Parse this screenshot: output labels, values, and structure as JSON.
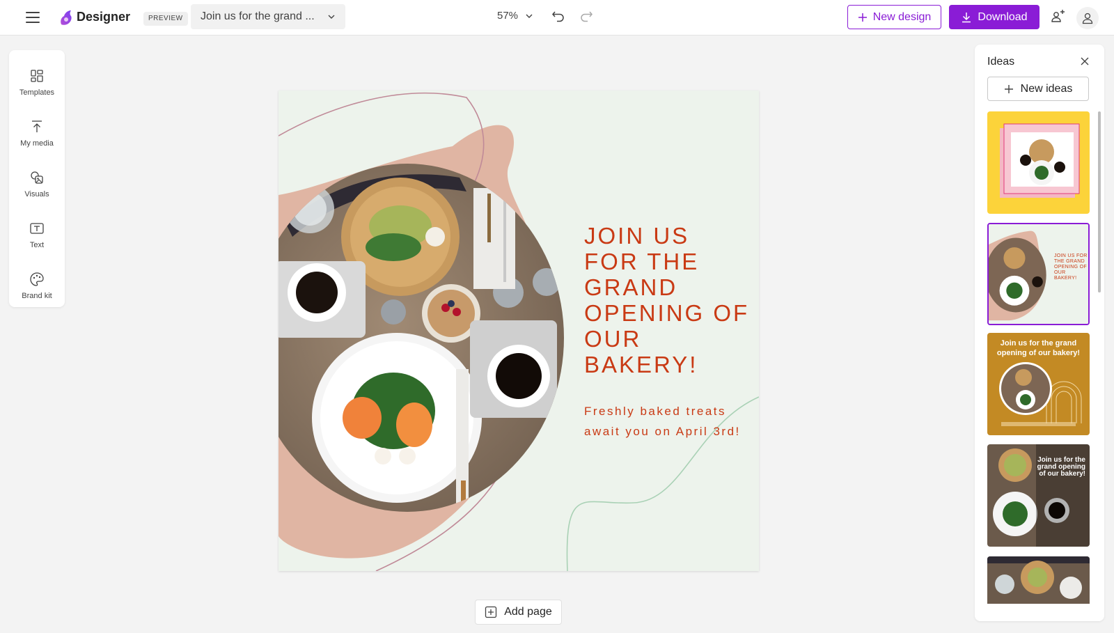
{
  "header": {
    "app_name": "Designer",
    "preview_badge": "PREVIEW",
    "design_title": "Join us for the grand ...",
    "zoom": "57%",
    "new_design_label": "New design",
    "download_label": "Download",
    "icons": [
      "menu-icon",
      "designer-logo-icon",
      "chevron-down-icon",
      "undo-icon",
      "redo-icon",
      "plus-icon",
      "download-icon",
      "share-icon",
      "account-icon"
    ]
  },
  "left_toolbar": {
    "items": [
      {
        "label": "Templates",
        "icon": "templates-icon"
      },
      {
        "label": "My media",
        "icon": "upload-icon"
      },
      {
        "label": "Visuals",
        "icon": "visuals-icon"
      },
      {
        "label": "Text",
        "icon": "text-icon"
      },
      {
        "label": "Brand kit",
        "icon": "palette-icon"
      }
    ]
  },
  "canvas": {
    "headline": "JOIN US FOR THE GRAND OPENING OF OUR BAKERY!",
    "subline": "Freshly baked treats await you on April 3rd!",
    "colors": {
      "background": "#edf3ec",
      "accent_blob": "#e0b5a3",
      "text": "#c93a14",
      "line_green": "#a9d1b5",
      "line_mauve": "#c08a98"
    }
  },
  "add_page_label": "Add page",
  "ideas_panel": {
    "title": "Ideas",
    "new_ideas_label": "New ideas",
    "thumbnails": [
      {
        "style": "yellow-pink-frames",
        "selected": false
      },
      {
        "style": "mint-blob",
        "selected": true,
        "text": "JOIN US FOR THE GRAND OPENING OF OUR BAKERY!"
      },
      {
        "style": "mustard-arches",
        "selected": false,
        "text": "Join us for the grand opening of our bakery!"
      },
      {
        "style": "photo-overlay",
        "selected": false,
        "text": "Join us for the grand opening of our bakery!"
      },
      {
        "style": "photo-plain",
        "selected": false
      }
    ],
    "accent": "#8a1cd6"
  }
}
